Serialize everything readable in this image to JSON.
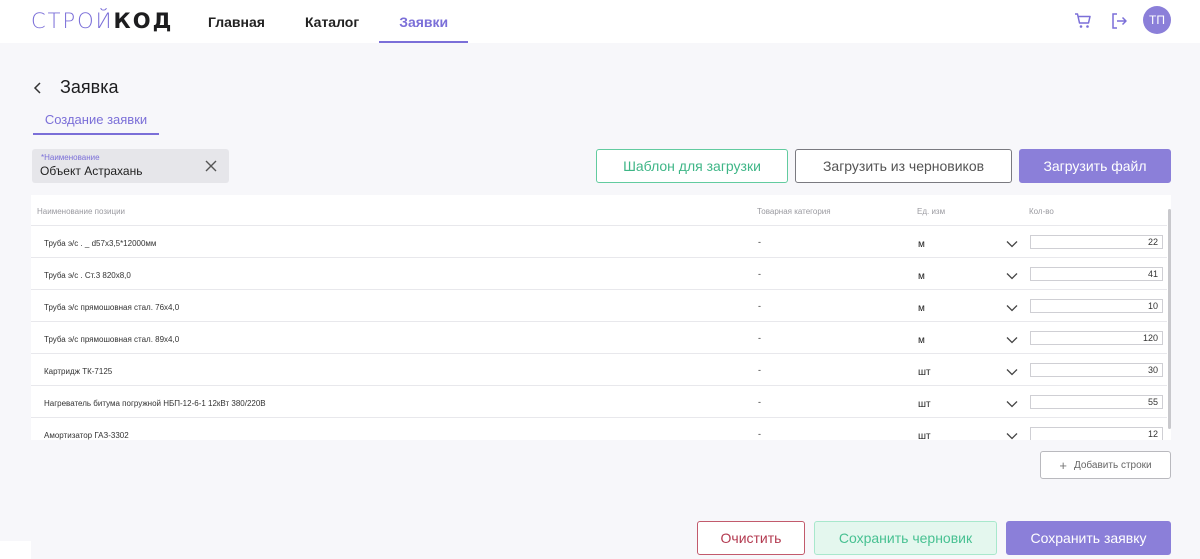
{
  "logo": {
    "part1": "СТРОЙ",
    "part2": "КОД"
  },
  "nav": {
    "items": [
      {
        "label": "Главная",
        "active": false
      },
      {
        "label": "Каталог",
        "active": false
      },
      {
        "label": "Заявки",
        "active": true
      }
    ]
  },
  "header": {
    "avatar_initials": "ТП",
    "cart_icon": "cart-icon",
    "logout_icon": "logout-icon"
  },
  "page": {
    "title": "Заявка",
    "subtab": "Создание заявки"
  },
  "name_field": {
    "label": "*Наименование",
    "value": "Объект Астрахань"
  },
  "top_buttons": {
    "template": "Шаблон для загрузки",
    "drafts": "Загрузить из черновиков",
    "upload": "Загрузить файл"
  },
  "table": {
    "columns": [
      "Наименование позиции",
      "Товарная категория",
      "Ед. изм",
      "Кол-во"
    ],
    "rows": [
      {
        "name": "Труба э/с . _ d57x3,5*12000мм",
        "category": "-",
        "unit": "м",
        "qty": "22"
      },
      {
        "name": "Труба э/с . Ст.3 820x8,0",
        "category": "-",
        "unit": "м",
        "qty": "41"
      },
      {
        "name": "Труба э/с прямошовная стал. 76x4,0",
        "category": "-",
        "unit": "м",
        "qty": "10"
      },
      {
        "name": "Труба э/с прямошовная стал. 89x4,0",
        "category": "-",
        "unit": "м",
        "qty": "120"
      },
      {
        "name": "Картридж ТК-7125",
        "category": "-",
        "unit": "шт",
        "qty": "30"
      },
      {
        "name": "Нагреватель битума погружной НБП-12-6-1 12кВт 380/220В",
        "category": "-",
        "unit": "шт",
        "qty": "55"
      },
      {
        "name": "Амортизатор ГАЗ-3302",
        "category": "-",
        "unit": "шт",
        "qty": "12"
      }
    ]
  },
  "add_rows_label": "Добавить строки",
  "bottom_buttons": {
    "clear": "Очистить",
    "save_draft": "Сохранить черновик",
    "save": "Сохранить заявку"
  },
  "colors": {
    "accent": "#8b7fd9",
    "green": "#48c192",
    "red": "#b33a50"
  }
}
